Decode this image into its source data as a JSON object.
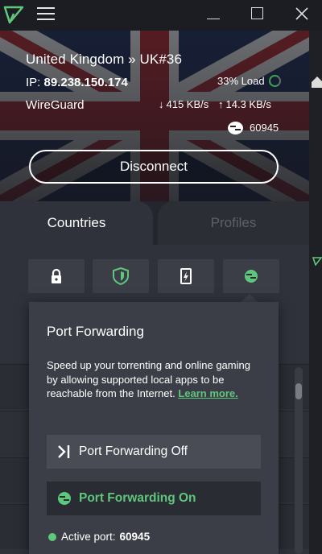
{
  "server": {
    "location": "United Kingdom » UK#36",
    "ip_label": "IP:",
    "ip": "89.238.150.174",
    "load": "33% Load",
    "protocol": "WireGuard",
    "download": "415 KB/s",
    "upload": "14.3 KB/s",
    "port": "60945"
  },
  "actions": {
    "disconnect": "Disconnect"
  },
  "tabs": [
    "Countries",
    "Profiles"
  ],
  "filters": [
    "lock-icon",
    "shield-icon",
    "tor-icon",
    "port-forwarding-icon"
  ],
  "popover": {
    "title": "Port Forwarding",
    "description": "Speed up your torrenting and online gaming by allowing supported local apps to be reachable from the Internet.",
    "link": "Learn more.",
    "options": [
      "Port Forwarding Off",
      "Port Forwarding On"
    ],
    "active_port_label": "Active port:",
    "active_port": "60945"
  },
  "colors": {
    "accent": "#5fc77c",
    "background": "#25262d",
    "panel": "#3c3e47"
  }
}
